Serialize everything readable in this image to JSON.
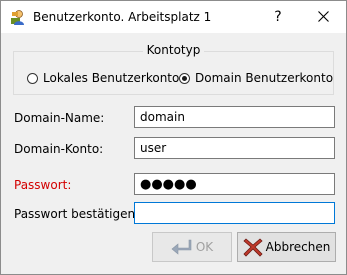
{
  "window": {
    "title": "Benutzerkonto. Arbeitsplatz 1",
    "help_glyph": "?",
    "close_glyph": "✕"
  },
  "account_type": {
    "title": "Kontotyp",
    "options": [
      {
        "label": "Lokales Benutzerkonto",
        "selected": false
      },
      {
        "label": "Domain Benutzerkonto",
        "selected": true
      }
    ]
  },
  "form": {
    "domain_name_label": "Domain-Name:",
    "domain_name_value": "domain",
    "domain_account_label": "Domain-Konto:",
    "domain_account_value": "user",
    "password_label": "Passwort:",
    "password_value": "●●●●●",
    "password_confirm_label": "Passwort bestätigen:",
    "password_confirm_value": ""
  },
  "buttons": {
    "ok_label": "OK",
    "cancel_label": "Abbrechen"
  },
  "colors": {
    "password_label": "#d30000",
    "focus_border": "#0078d7",
    "cancel_icon": "#c0392b"
  }
}
